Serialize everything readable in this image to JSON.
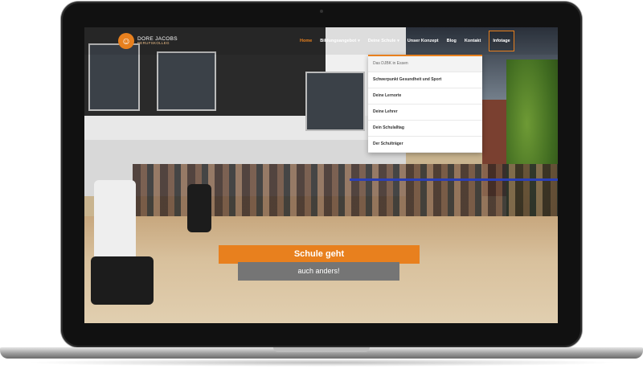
{
  "logo": {
    "name": "DORE JACOBS",
    "subtitle": "BERUFSKOLLEG",
    "mark": "☺"
  },
  "nav": {
    "items": [
      {
        "label": "Home",
        "active": true
      },
      {
        "label": "Bildungsangebot",
        "chevron": "▾"
      },
      {
        "label": "Deine Schule",
        "chevron": "▾"
      },
      {
        "label": "Unser Konzept"
      },
      {
        "label": "Blog"
      },
      {
        "label": "Kontakt"
      },
      {
        "label": "Infotage",
        "highlight": true
      }
    ]
  },
  "dropdown": {
    "items": [
      "Das DJBK in Essen",
      "Schwerpunkt Gesundheit und Sport",
      "Deine Lernorte",
      "Deine Lehrer",
      "Dein Schulalltag",
      "Der Schulträger"
    ]
  },
  "hero": {
    "line1": "Schule geht",
    "line2": "auch anders!"
  },
  "colors": {
    "accent": "#e8801e",
    "banner_gray": "#757575"
  }
}
